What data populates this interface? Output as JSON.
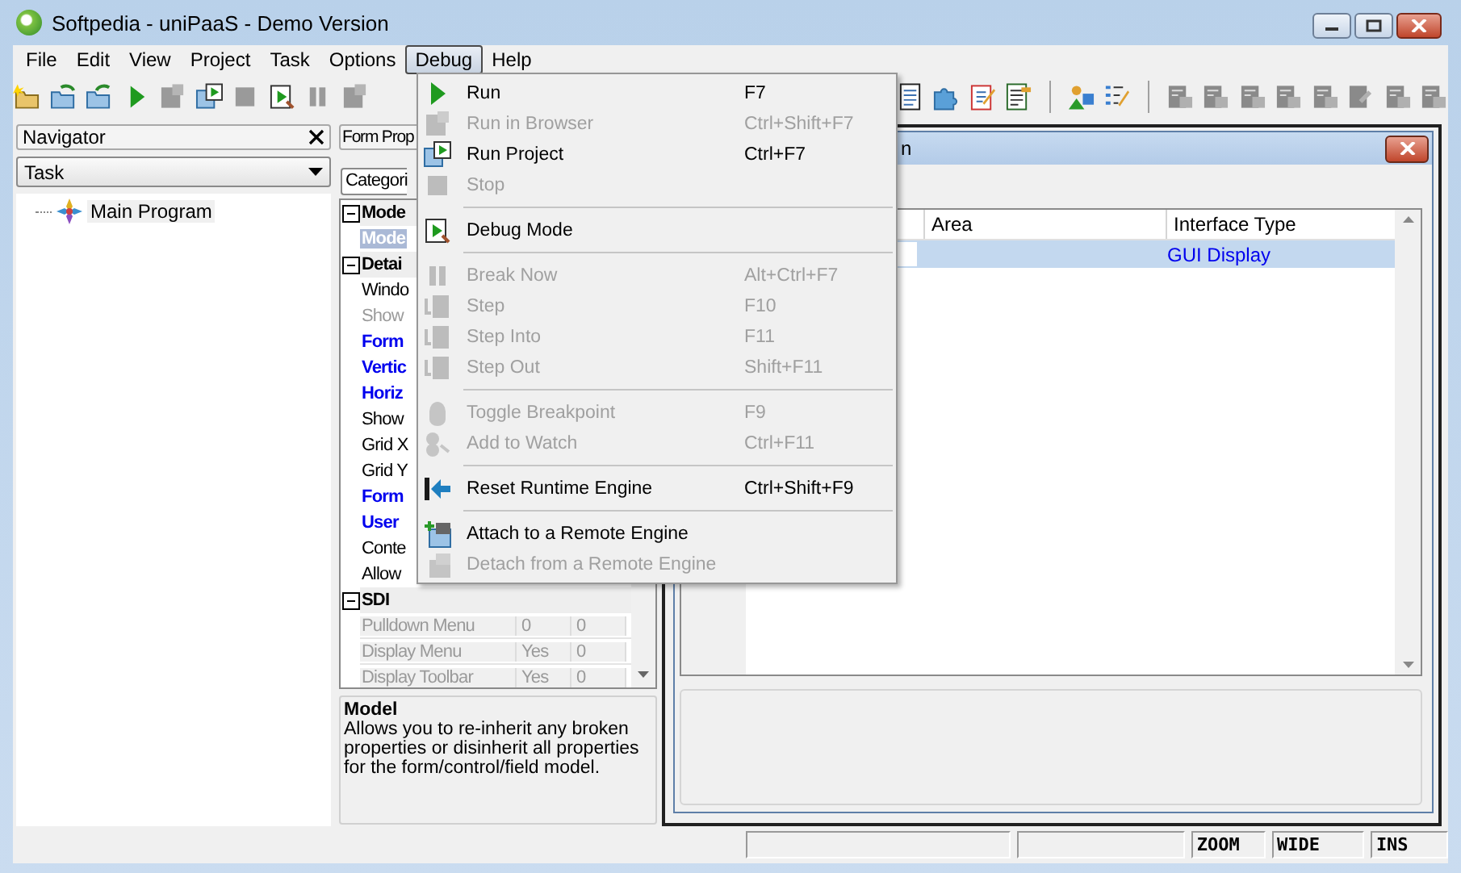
{
  "window": {
    "title": "Softpedia - uniPaaS - Demo Version"
  },
  "menu_bar": [
    {
      "label": "File",
      "selected": false
    },
    {
      "label": "Edit",
      "selected": false
    },
    {
      "label": "View",
      "selected": false
    },
    {
      "label": "Project",
      "selected": false
    },
    {
      "label": "Task",
      "selected": false
    },
    {
      "label": "Options",
      "selected": false
    },
    {
      "label": "Debug",
      "selected": true
    },
    {
      "label": "Help",
      "selected": false
    }
  ],
  "navigator": {
    "title": "Navigator",
    "dropdown": "Task",
    "tree": [
      {
        "label": "Main Program"
      }
    ]
  },
  "form_properties": {
    "title": "Form Prop",
    "tab": "Categori",
    "rows": [
      {
        "kind": "section",
        "label": "Mode"
      },
      {
        "kind": "property",
        "label": "Mode",
        "selected": true,
        "emphasized": false,
        "disabled": false
      },
      {
        "kind": "section",
        "label": "Detai"
      },
      {
        "kind": "property",
        "label": "Windo",
        "selected": false,
        "emphasized": false,
        "disabled": false
      },
      {
        "kind": "property",
        "label": "Show",
        "selected": false,
        "emphasized": false,
        "disabled": true
      },
      {
        "kind": "property",
        "label": "Form",
        "selected": false,
        "emphasized": true,
        "disabled": false
      },
      {
        "kind": "property",
        "label": "Vertic",
        "selected": false,
        "emphasized": true,
        "disabled": false
      },
      {
        "kind": "property",
        "label": "Horiz",
        "selected": false,
        "emphasized": true,
        "disabled": false
      },
      {
        "kind": "property",
        "label": "Show",
        "selected": false,
        "emphasized": false,
        "disabled": false
      },
      {
        "kind": "property",
        "label": "Grid X",
        "selected": false,
        "emphasized": false,
        "disabled": false
      },
      {
        "kind": "property",
        "label": "Grid Y",
        "selected": false,
        "emphasized": false,
        "disabled": false
      },
      {
        "kind": "property",
        "label": "Form",
        "selected": false,
        "emphasized": true,
        "disabled": false
      },
      {
        "kind": "property",
        "label": "User",
        "selected": false,
        "emphasized": true,
        "disabled": false
      },
      {
        "kind": "property",
        "label": "Conte",
        "selected": false,
        "emphasized": false,
        "disabled": false
      },
      {
        "kind": "property",
        "label": "Allow",
        "selected": false,
        "emphasized": false,
        "disabled": false
      },
      {
        "kind": "section",
        "label": "SDI"
      },
      {
        "kind": "value_row",
        "label": "Pulldown Menu",
        "values": [
          "0",
          "0"
        ],
        "selected": false,
        "disabled": true
      },
      {
        "kind": "value_row",
        "label": "Display Menu",
        "values": [
          "Yes",
          "0"
        ],
        "selected": false,
        "disabled": true
      },
      {
        "kind": "value_row",
        "label": "Display Toolbar",
        "values": [
          "Yes",
          "0"
        ],
        "selected": false,
        "disabled": true
      }
    ],
    "description": {
      "title": "Model",
      "text": "Allows you to re-inherit any broken properties or disinherit all properties for the form/control/field model."
    }
  },
  "child_window": {
    "title": "n",
    "table": {
      "columns": [
        "Area",
        "Interface Type"
      ],
      "rows": [
        {
          "cells": [
            "",
            "GUI Display"
          ],
          "selected": true
        }
      ]
    }
  },
  "debug_menu": [
    {
      "kind": "item",
      "label": "Run",
      "shortcut": "F7",
      "disabled": false
    },
    {
      "kind": "item",
      "label": "Run in Browser",
      "shortcut": "Ctrl+Shift+F7",
      "disabled": true
    },
    {
      "kind": "item",
      "label": "Run Project",
      "shortcut": "Ctrl+F7",
      "disabled": false
    },
    {
      "kind": "item",
      "label": "Stop",
      "disabled": true
    },
    {
      "kind": "separator"
    },
    {
      "kind": "item",
      "label": "Debug Mode",
      "disabled": false
    },
    {
      "kind": "separator"
    },
    {
      "kind": "item",
      "label": "Break Now",
      "shortcut": "Alt+Ctrl+F7",
      "disabled": true
    },
    {
      "kind": "item",
      "label": "Step",
      "shortcut": "F10",
      "disabled": true
    },
    {
      "kind": "item",
      "label": "Step Into",
      "shortcut": "F11",
      "disabled": true
    },
    {
      "kind": "item",
      "label": "Step Out",
      "shortcut": "Shift+F11",
      "disabled": true
    },
    {
      "kind": "separator"
    },
    {
      "kind": "item",
      "label": "Toggle Breakpoint",
      "shortcut": "F9",
      "disabled": true
    },
    {
      "kind": "item",
      "label": "Add to Watch",
      "shortcut": "Ctrl+F11",
      "disabled": true
    },
    {
      "kind": "separator"
    },
    {
      "kind": "item",
      "label": "Reset Runtime Engine",
      "shortcut": "Ctrl+Shift+F9",
      "disabled": false
    },
    {
      "kind": "separator"
    },
    {
      "kind": "item",
      "label": "Attach to a Remote Engine",
      "disabled": false
    },
    {
      "kind": "item",
      "label": "Detach from a Remote Engine",
      "disabled": true
    }
  ],
  "status_bar": [
    "ZOOM",
    "WIDE",
    "INS"
  ]
}
